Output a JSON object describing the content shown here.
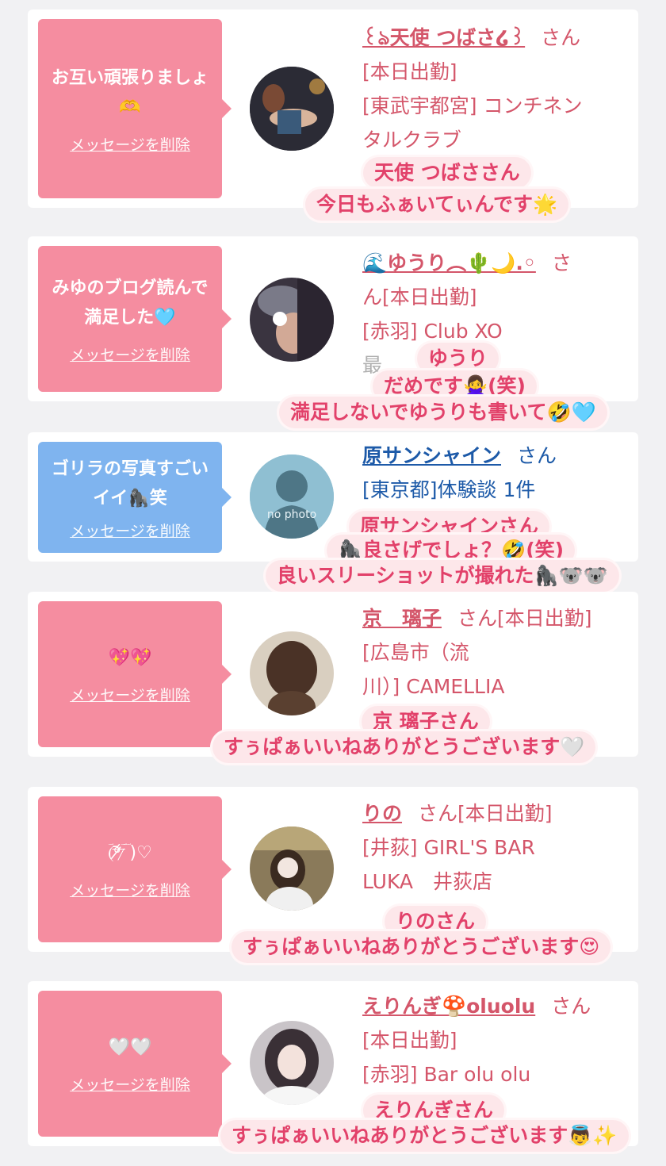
{
  "cards": [
    {
      "message": "お互い頑張りましょ🫶",
      "delete_label": "メッセージを削除",
      "name": "꒰ঌ天使 つばさ໒꒱",
      "san": "さん",
      "lines": [
        "[本日出勤]",
        "[東武宇都宮] コンチネン",
        "タルクラブ"
      ],
      "stickers": [
        "天使 つばささん",
        "今日もふぁいてぃんです🌟"
      ]
    },
    {
      "message": "みゆのブログ読んで満足した🩵",
      "delete_label": "メッセージを削除",
      "name": "🌊ゆうり︵🌵🌙.◦",
      "san": "さ",
      "lines": [
        "ん[本日出勤]",
        "[赤羽] Club XO",
        "最"
      ],
      "stickers": [
        "ゆうり",
        "だめです🙅‍♀️(笑)",
        "満足しないでゆうりも書いて🤣🩵"
      ]
    },
    {
      "message": "ゴリラの写真すごいイイ🦍笑",
      "delete_label": "メッセージを削除",
      "name": "原サンシャイン",
      "san": "さん",
      "lines": [
        "[東京都]体験談 1件"
      ],
      "avatar_text": "no photo",
      "stickers": [
        "原サンシャインさん",
        "🦍良さげでしょ？🤣(笑)",
        "良いスリーショットが撮れた🦍🐨🐨"
      ]
    },
    {
      "message": "💖💖",
      "delete_label": "メッセージを削除",
      "name": "京　璃子",
      "san": "さん[本日出勤]",
      "lines": [
        "[広島市（流",
        "川）] CAMELLIA"
      ],
      "stickers": [
        "京 璃子さん",
        "すぅぱぁいいねありがとうございます🤍"
      ]
    },
    {
      "message": "(ؔᵒ̷̷᷄ؔ ᷄ؔ ̷̷᷅ؔ)♡",
      "delete_label": "メッセージを削除",
      "name": "りの",
      "san": "さん[本日出勤]",
      "lines": [
        "[井荻] GIRL'S BAR",
        "LUKA　井荻店"
      ],
      "stickers": [
        "りのさん",
        "すぅぱぁいいねありがとうございます😍"
      ]
    },
    {
      "message": "🤍🤍",
      "delete_label": "メッセージを削除",
      "name": "えりんぎ🍄oluolu",
      "san": "さん",
      "lines": [
        "[本日出勤]",
        "[赤羽] Bar olu olu"
      ],
      "stickers": [
        "えりんぎさん",
        "すぅぱぁいいねありがとうございます👼✨"
      ]
    }
  ],
  "colors": {
    "bubble_pink": "#f58da0",
    "bubble_blue": "#7fb4ef",
    "name_pink": "#d4566a",
    "name_blue": "#1d5aa8",
    "sticker_text": "#e2416a",
    "sticker_bg": "#fde7ea"
  }
}
